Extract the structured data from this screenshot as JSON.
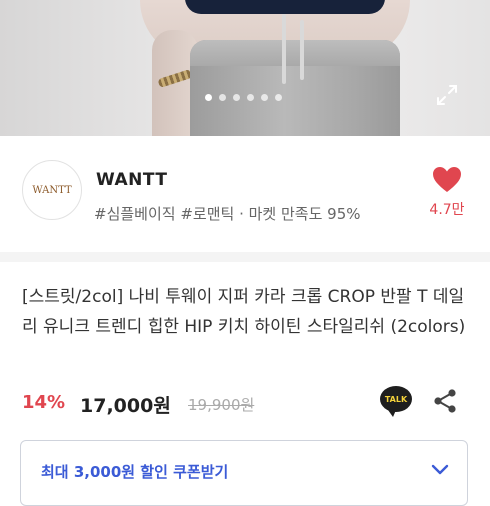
{
  "product_image": {
    "carousel_total": 6,
    "carousel_active_index": 0
  },
  "seller": {
    "logo_text": "WANTT",
    "name": "WANTT",
    "tags": "#심플베이직 #로맨틱 · 마켓 만족도 95%",
    "like_count": "4.7만"
  },
  "product": {
    "title": "[스트릿/2col] 나비 투웨이 지퍼 카라 크롭 CROP 반팔 T 데일리 유니크 트렌디 힙한 HIP 키치 하이틴 스타일리쉬 (2colors)",
    "discount": "14%",
    "price": "17,000원",
    "original_price": "19,900원",
    "talk_label": "TALK"
  },
  "coupon": {
    "label": "최대 3,000원 할인 쿠폰받기"
  },
  "colors": {
    "accent_red": "#e0464f",
    "coupon_blue": "#3b5bd6"
  },
  "icons": [
    "expand-icon",
    "heart-icon",
    "kakaotalk-icon",
    "share-icon",
    "chevron-down-icon"
  ]
}
